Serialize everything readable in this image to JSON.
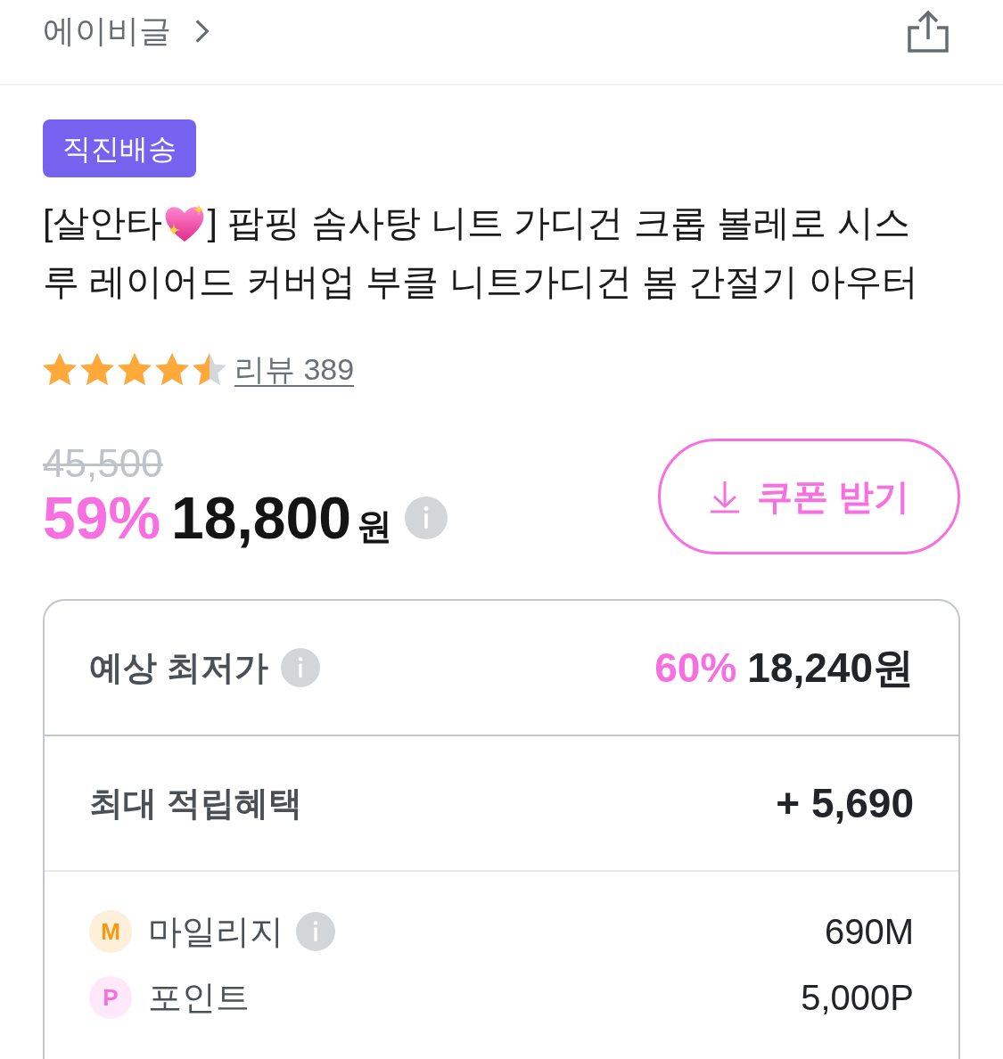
{
  "header": {
    "brand": "에이비글"
  },
  "badge": "직진배송",
  "title": {
    "lines": [
      {
        "parts": [
          {
            "kind": "text",
            "text": "[살안타"
          },
          {
            "kind": "emoji"
          },
          {
            "kind": "text",
            "text": "] 팝핑 솜사탕 니트 가디건 크롭 볼레로 시스"
          }
        ]
      },
      {
        "parts": [
          {
            "kind": "text",
            "text": "루 레이어드 커버업 부클 니트가디건 봄 간절기 아우터"
          }
        ]
      }
    ]
  },
  "rating": {
    "stars": 4.5,
    "reviews": "리뷰 389"
  },
  "price": {
    "original": "45,500",
    "discount": "59%",
    "amount": "18,800",
    "currency": "원",
    "info": true
  },
  "coupon_button": {
    "label": "쿠폰 받기"
  },
  "summary": {
    "rows": [
      {
        "kind": "lowest_price",
        "label": "예상 최저가",
        "info": true,
        "discount": "60%",
        "value": "18,240원"
      },
      {
        "kind": "benefit",
        "label": "최대 적립혜택",
        "info": false,
        "value": "+ 5,690"
      }
    ],
    "rewards": [
      {
        "mark": "M",
        "label": "마일리지",
        "info": true,
        "value": "690M",
        "color": "#f59a0f"
      },
      {
        "mark": "P",
        "label": "포인트",
        "info": false,
        "value": "5,000P",
        "color": "#f76fe0"
      }
    ]
  }
}
